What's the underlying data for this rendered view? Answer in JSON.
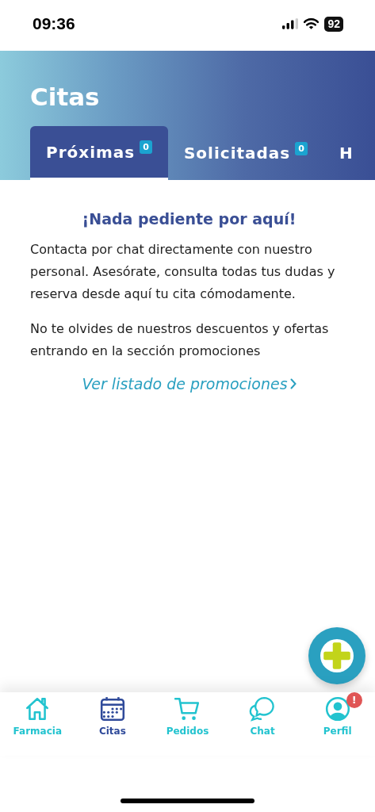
{
  "status_bar": {
    "time": "09:36",
    "battery": "92"
  },
  "header": {
    "title": "Citas"
  },
  "tabs": [
    {
      "label": "Próximas",
      "count": "0",
      "selected": true
    },
    {
      "label": "Solicitadas",
      "count": "0",
      "selected": false
    },
    {
      "label": "H",
      "selected": false
    }
  ],
  "empty_state": {
    "heading": "¡Nada pediente por aquí!",
    "paragraphs": [
      "Contacta por chat directamente con nuestro personal. Asesórate, consulta todas tus dudas y reserva desde aquí tu cita cómodamente.",
      "No te olvides de nuestros descuentos y ofertas entrando en la sección promociones"
    ],
    "link": "Ver listado de promociones"
  },
  "bottom_nav": [
    {
      "kind": "home",
      "label": "Farmacia",
      "selected": false
    },
    {
      "kind": "calendar",
      "label": "Citas",
      "selected": true
    },
    {
      "kind": "cart",
      "label": "Pedidos",
      "selected": false
    },
    {
      "kind": "chat",
      "label": "Chat",
      "selected": false
    },
    {
      "kind": "profile",
      "label": "Perfil",
      "selected": false,
      "badge": "!"
    }
  ]
}
